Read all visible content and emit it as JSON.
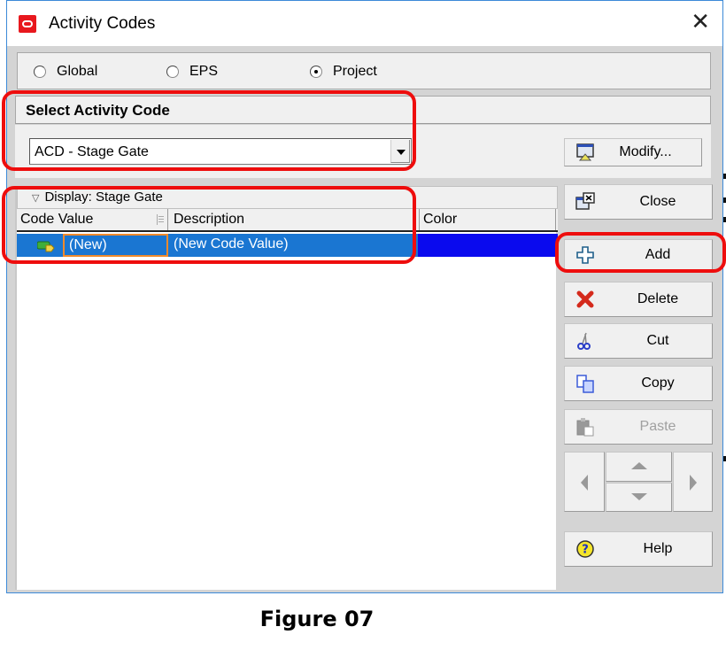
{
  "window": {
    "title": "Activity Codes",
    "close_glyph": "✕"
  },
  "scope": {
    "options": [
      {
        "label": "Global",
        "selected": false
      },
      {
        "label": "EPS",
        "selected": false
      },
      {
        "label": "Project",
        "selected": true
      }
    ]
  },
  "select_code": {
    "heading": "Select Activity Code",
    "selected_value": "ACD - Stage Gate"
  },
  "buttons": {
    "modify": "Modify...",
    "close": "Close",
    "add": "Add",
    "delete": "Delete",
    "cut": "Cut",
    "copy": "Copy",
    "paste": "Paste",
    "help": "Help"
  },
  "grid": {
    "display_label": "Display: Stage Gate",
    "columns": [
      "Code Value",
      "Description",
      "Color"
    ],
    "rows": [
      {
        "code_value": "(New)",
        "description": "(New Code Value)",
        "color": "#0a0aee",
        "selected": true
      }
    ]
  },
  "colors": {
    "selection": "#1a76d2",
    "annotation": "#ee0d0d",
    "edit_border": "#f08a2c"
  },
  "caption": "Figure 07"
}
